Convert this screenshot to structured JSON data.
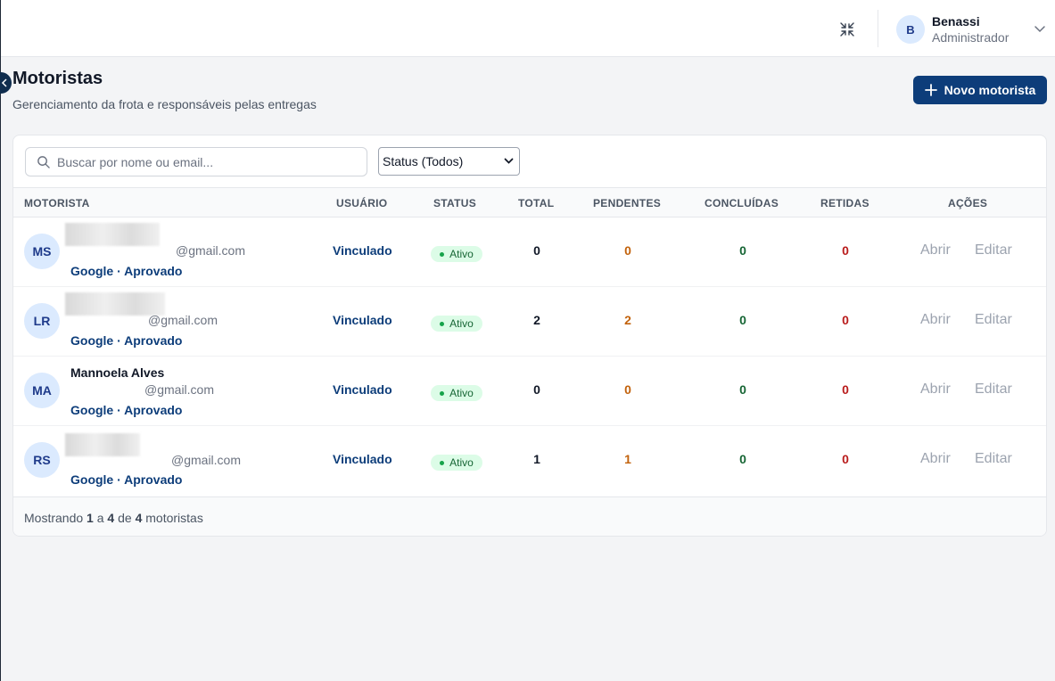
{
  "header": {
    "user": {
      "initial": "B",
      "name": "Benassi",
      "role": "Administrador"
    },
    "icons": {
      "compress": "compress-icon",
      "chevron": "chevron-down-icon"
    }
  },
  "page": {
    "title": "Motoristas",
    "subtitle": "Gerenciamento da frota e responsáveis pelas entregas",
    "new_button_label": "Novo motorista"
  },
  "filters": {
    "search_placeholder": "Buscar por nome ou email...",
    "search_value": "",
    "status_selected": "Status (Todos)"
  },
  "table": {
    "columns": [
      "MOTORISTA",
      "USUÁRIO",
      "STATUS",
      "TOTAL",
      "PENDENTES",
      "CONCLUÍDAS",
      "RETIDAS",
      "AÇÕES"
    ],
    "rows": [
      {
        "initials": "MS",
        "name": "",
        "email": "@gmail.com",
        "provider": "Google · Aprovado",
        "user": "Vinculado",
        "status": "Ativo",
        "total": "0",
        "pending": "0",
        "done": "0",
        "held": "0",
        "open": "Abrir",
        "edit": "Editar"
      },
      {
        "initials": "LR",
        "name": "",
        "email": "@gmail.com",
        "provider": "Google · Aprovado",
        "user": "Vinculado",
        "status": "Ativo",
        "total": "2",
        "pending": "2",
        "done": "0",
        "held": "0",
        "open": "Abrir",
        "edit": "Editar"
      },
      {
        "initials": "MA",
        "name": "Mannoela Alves",
        "email": "@gmail.com",
        "provider": "Google · Aprovado",
        "user": "Vinculado",
        "status": "Ativo",
        "total": "0",
        "pending": "0",
        "done": "0",
        "held": "0",
        "open": "Abrir",
        "edit": "Editar"
      },
      {
        "initials": "RS",
        "name": "",
        "email": "@gmail.com",
        "provider": "Google · Aprovado",
        "user": "Vinculado",
        "status": "Ativo",
        "total": "1",
        "pending": "1",
        "done": "0",
        "held": "0",
        "open": "Abrir",
        "edit": "Editar"
      }
    ]
  },
  "footer": {
    "prefix": "Mostrando",
    "from": "1",
    "sep1": "a",
    "to": "4",
    "sep2": "de",
    "count": "4",
    "suffix": "motoristas"
  },
  "colors": {
    "primary": "#0d3d7a",
    "pending": "#c2620c",
    "done": "#166534",
    "held": "#b91c1c",
    "badge_bg": "#dcfce7"
  }
}
